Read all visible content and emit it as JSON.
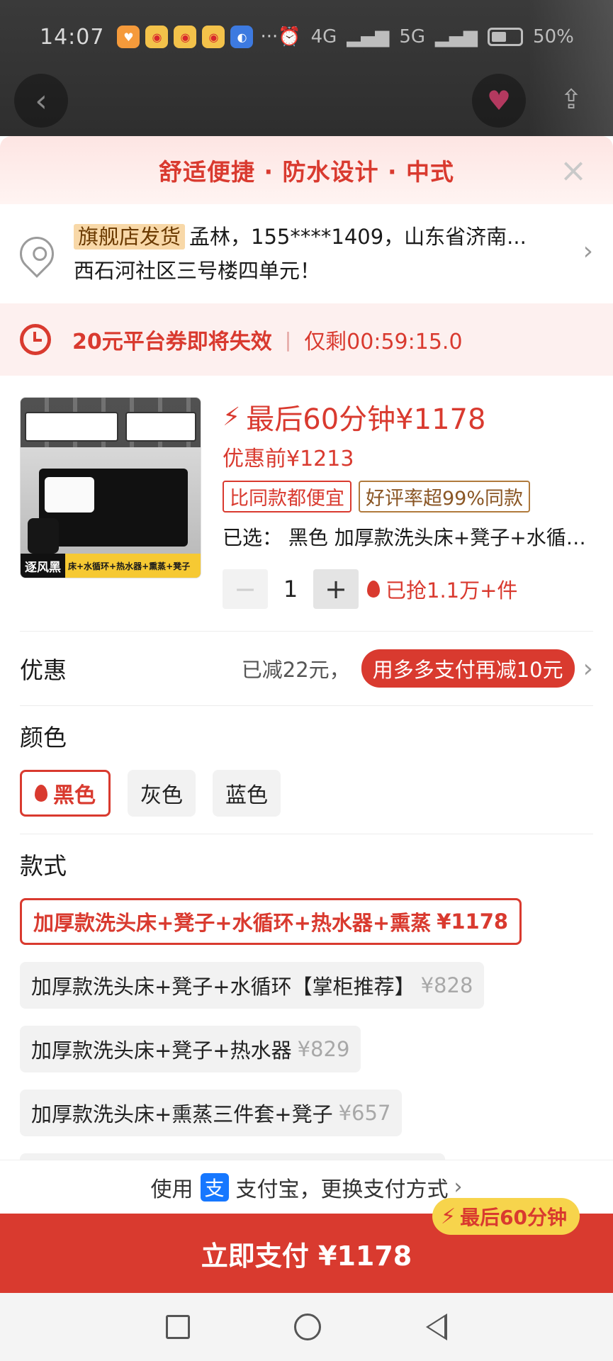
{
  "status_bar": {
    "time": "14:07",
    "dots": "···",
    "network1": "4G",
    "network2": "5G",
    "battery": "50%"
  },
  "header": {
    "title": "舒适便捷 · 防水设计 · 中式",
    "close_icon": "close-icon"
  },
  "address": {
    "badge": "旗舰店发货",
    "line1": "孟林，155****1409，山东省济南...",
    "line2": "西石河社区三号楼四单元！"
  },
  "coupon": {
    "text": "20元平台券即将失效",
    "sep": "|",
    "timer": "仅剩00:59:15.0"
  },
  "product": {
    "image_tag_left": "逐风黑",
    "image_tag_right": "床+水循环+热水器+熏蒸+凳子",
    "price_label": "最后60分钟¥1178",
    "original_price": "优惠前¥1213",
    "tag1": "比同款都便宜",
    "tag2": "好评率超99%同款",
    "selected": "已选：  黑色 加厚款洗头床+凳子+水循环+热水器+熏蒸",
    "quantity": "1",
    "minus": "−",
    "plus": "+",
    "grabbed": "已抢1.1万+件"
  },
  "promo": {
    "label": "优惠",
    "reduced": "已减22元，",
    "pill": "用多多支付再减10元"
  },
  "color": {
    "label": "颜色",
    "options": [
      "黑色",
      "灰色",
      "蓝色"
    ],
    "selected_index": 0
  },
  "style": {
    "label": "款式",
    "options": [
      {
        "name": "加厚款洗头床+凳子+水循环+热水器+熏蒸",
        "price": "¥1178"
      },
      {
        "name": "加厚款洗头床+凳子+水循环【掌柜推荐】",
        "price": "¥828"
      },
      {
        "name": "加厚款洗头床+凳子+热水器",
        "price": "¥829"
      },
      {
        "name": "加厚款洗头床+熏蒸三件套+凳子",
        "price": "¥657"
      }
    ]
  },
  "payment": {
    "prefix": "使用",
    "alipay_glyph": "支",
    "method": "支付宝，更换支付方式",
    "button": "立即支付 ¥1178",
    "badge": "最后60分钟"
  },
  "colors": {
    "accent": "#d93a2f",
    "alipay": "#1677ff",
    "badge_yellow": "#f7d44c"
  }
}
